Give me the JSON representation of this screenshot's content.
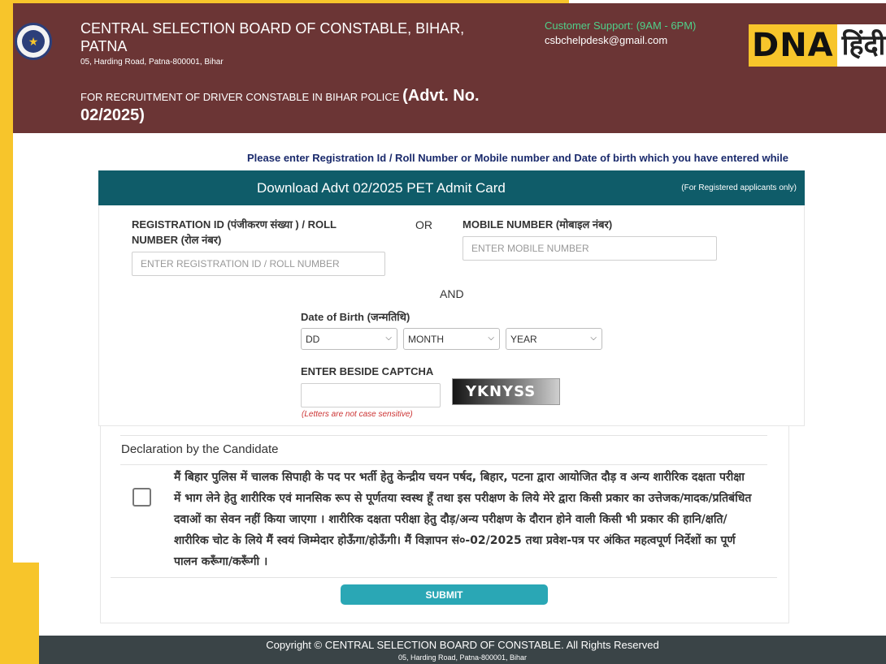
{
  "header": {
    "board_title": "CENTRAL SELECTION BOARD OF CONSTABLE, BIHAR, PATNA",
    "address": "05, Harding Road, Patna-800001, Bihar",
    "recruit_prefix": "FOR RECRUITMENT OF DRIVER CONSTABLE IN BIHAR POLICE",
    "advt_number": "(Advt. No. 02/2025)",
    "support_label": "Customer Support: (9AM - 6PM)",
    "support_email": "csbchelpdesk@gmail.com",
    "watermark_latin": "DNA",
    "watermark_hindi": "हिंदी"
  },
  "instruction": "Please enter Registration Id / Roll Number or Mobile number and Date of birth which you have entered while",
  "card": {
    "title": "Download Advt 02/2025 PET Admit Card",
    "note": "(For Registered applicants only)"
  },
  "form": {
    "registration_label": "REGISTRATION ID (पंजीकरण संख्या ) / ROLL NUMBER (रोल नंबर)",
    "registration_placeholder": "ENTER REGISTRATION ID / ROLL NUMBER",
    "or_text": "OR",
    "mobile_label": "MOBILE NUMBER (मोबाइल नंबर)",
    "mobile_placeholder": "ENTER MOBILE NUMBER",
    "and_text": "AND",
    "dob_label": "Date of Birth (जन्मतिथि)",
    "dob_day": "DD",
    "dob_month": "MONTH",
    "dob_year": "YEAR",
    "captcha_label": "ENTER BESIDE CAPTCHA",
    "captcha_text": "YKNYSS",
    "captcha_hint": "(Letters are not case sensitive)"
  },
  "declaration": {
    "title": "Declaration by the Candidate",
    "text": "मैं बिहार पुलिस में चालक सिपाही के पद पर भर्ती हेतु केन्द्रीय चयन पर्षद, बिहार, पटना द्वारा आयोजित दौड़ व अन्य शारीरिक दक्षता परीक्षा में भाग लेने हेतु शारीरिक एवं मानसिक रूप से पूर्णतया स्वस्थ हूँ तथा इस परीक्षण के लिये मेरे द्वारा किसी प्रकार का उत्तेजक/मादक/प्रतिबंधित दवाओं का सेवन नहीं किया जाएगा । शारीरिक दक्षता परीक्षा हेतु दौड़/अन्य परीक्षण के दौरान होने वाली किसी भी प्रकार की हानि/क्षति/शारीरिक चोट के लिये मैं स्वयं जिम्मेदार होऊँगा/होऊँगी। मैं विज्ञापन सं०-02/2025 तथा प्रवेश-पत्र पर अंकित महत्वपूर्ण निर्देशों का पूर्ण पालन करूँगा/करूँगी ।",
    "submit_label": "SUBMIT"
  },
  "footer": {
    "copyright": "Copyright © CENTRAL SELECTION BOARD OF CONSTABLE. All Rights Reserved",
    "address": "05, Harding Road, Patna-800001, Bihar"
  },
  "colors": {
    "header_bg": "#6b3535",
    "card_header_bg": "#0f5c69",
    "submit_bg": "#2aa7b5",
    "frame_yellow": "#f7c52b",
    "footer_bg": "#3a4447"
  },
  "icons": {
    "board_logo": "emblem-icon",
    "select_arrow": "chevron-down-icon"
  }
}
